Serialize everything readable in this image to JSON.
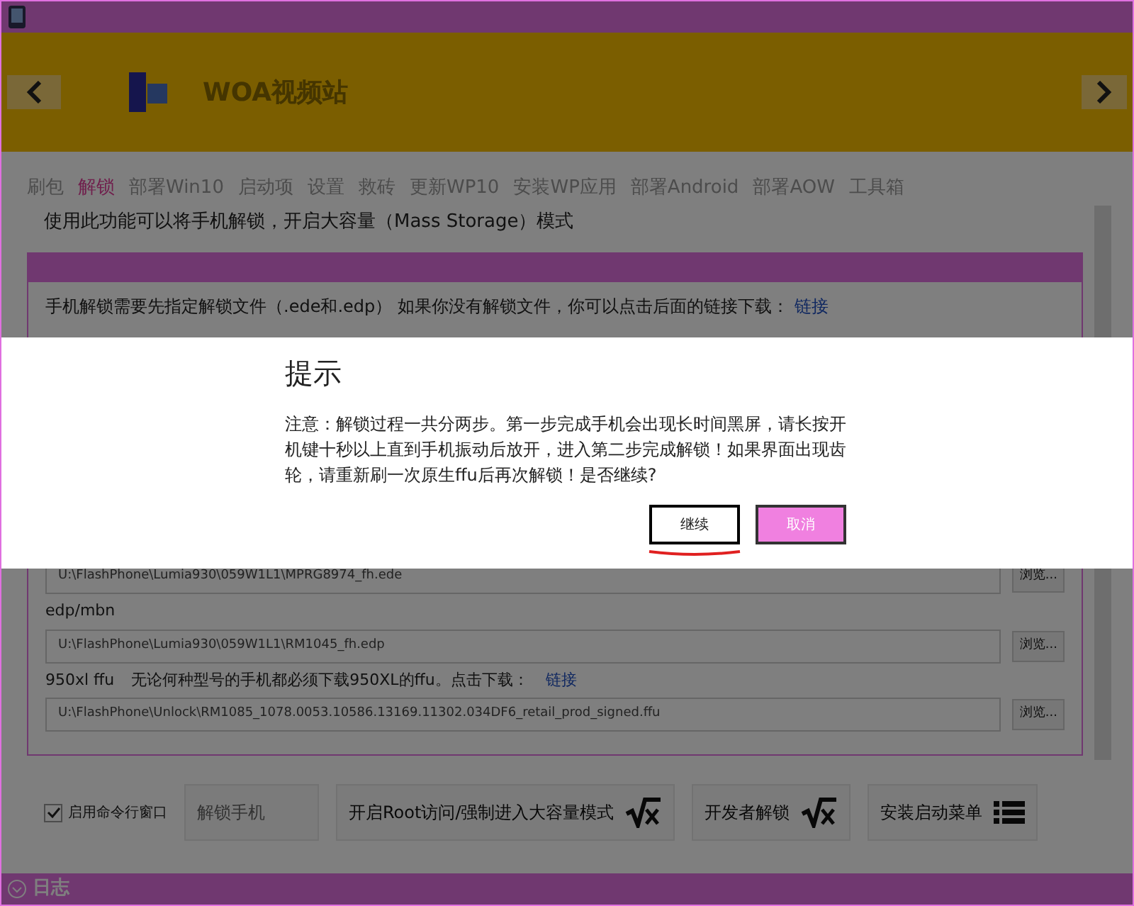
{
  "header": {
    "title": "WOA视频站"
  },
  "tabs": [
    {
      "label": "刷包",
      "selected": false
    },
    {
      "label": "解锁",
      "selected": true
    },
    {
      "label": "部署Win10",
      "selected": false
    },
    {
      "label": "启动项",
      "selected": false
    },
    {
      "label": "设置",
      "selected": false
    },
    {
      "label": "救砖",
      "selected": false
    },
    {
      "label": "更新WP10",
      "selected": false
    },
    {
      "label": "安装WP应用",
      "selected": false
    },
    {
      "label": "部署Android",
      "selected": false
    },
    {
      "label": "部署AOW",
      "selected": false
    },
    {
      "label": "工具箱",
      "selected": false
    }
  ],
  "intro": "使用此功能可以将手机解锁，开启大容量（Mass Storage）模式",
  "group": {
    "note": "手机解锁需要先指定解锁文件（.ede和.edp） 如果你没有解锁文件，你可以点击后面的链接下载：",
    "note_link": "链接",
    "files": [
      {
        "path": "U:\\FlashPhone\\Lumia930\\059W1L1\\MPRG8974_fh.ede",
        "browse": "浏览..."
      },
      {
        "label": "edp/mbn",
        "path": "U:\\FlashPhone\\Lumia930\\059W1L1\\RM1045_fh.edp",
        "browse": "浏览..."
      },
      {
        "label": "950xl ffu",
        "hint": "无论何种型号的手机都必须下载950XL的ffu。点击下载：",
        "link": "链接",
        "path": "U:\\FlashPhone\\Unlock\\RM1085_1078.0053.10586.13169.11302.034DF6_retail_prod_signed.ffu",
        "browse": "浏览..."
      }
    ]
  },
  "actions": {
    "checkbox": {
      "label": "启用命令行窗口",
      "checked": true
    },
    "buttons": [
      {
        "label": "解锁手机",
        "disabled": true,
        "kind": "plain"
      },
      {
        "label": "开启Root访问/强制进入大容量模式",
        "disabled": false,
        "kind": "sqrt"
      },
      {
        "label": "开发者解锁",
        "disabled": false,
        "kind": "sqrt"
      },
      {
        "label": "安装启动菜单",
        "disabled": false,
        "kind": "list"
      }
    ]
  },
  "status_bar": {
    "label": "日志"
  },
  "dialog": {
    "title": "提示",
    "message": "注意：解锁过程一共分两步。第一步完成手机会出现长时间黑屏，请长按开机键十秒以上直到手机振动后放开，进入第二步完成解锁！如果界面出现齿轮，请重新刷一次原生ffu后再次解锁！是否继续?",
    "buttons": [
      {
        "label": "继续",
        "kind": "focused"
      },
      {
        "label": "取消",
        "kind": "accent"
      }
    ]
  }
}
